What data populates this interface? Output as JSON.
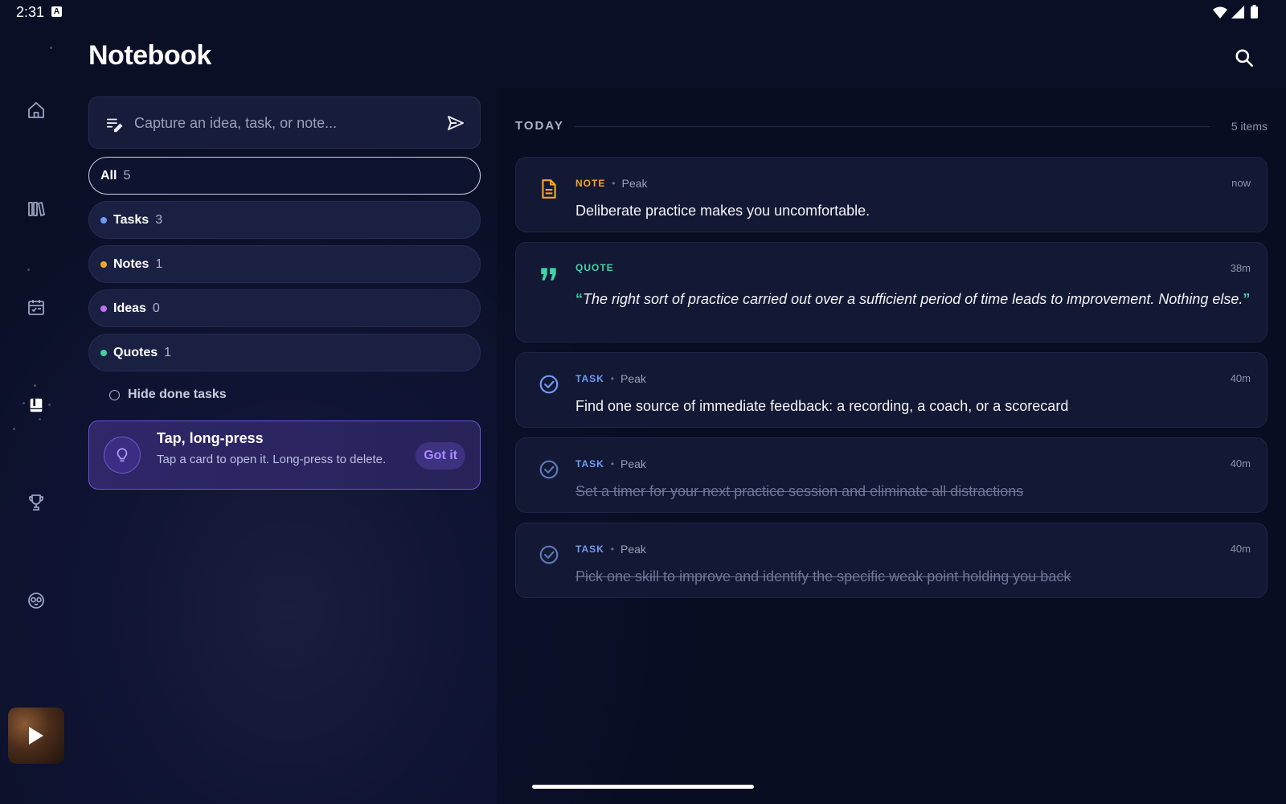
{
  "status_bar": {
    "time": "2:31",
    "badge": "A"
  },
  "header": {
    "title": "Notebook"
  },
  "nav": {
    "items": [
      {
        "id": "home",
        "icon": "home-icon"
      },
      {
        "id": "library",
        "icon": "library-icon"
      },
      {
        "id": "calendar",
        "icon": "calendar-icon"
      },
      {
        "id": "notebook",
        "icon": "notebook-icon",
        "active": true
      },
      {
        "id": "trophy",
        "icon": "trophy-icon"
      },
      {
        "id": "mascot",
        "icon": "owl-icon"
      }
    ]
  },
  "capture": {
    "placeholder": "Capture an idea, task, or note..."
  },
  "filters": [
    {
      "label": "All",
      "count": "5",
      "active": true
    },
    {
      "label": "Tasks",
      "count": "3",
      "color": "#6f9cf5"
    },
    {
      "label": "Notes",
      "count": "1",
      "color": "#f5a524"
    },
    {
      "label": "Ideas",
      "count": "0",
      "color": "#c56ef0"
    },
    {
      "label": "Quotes",
      "count": "1",
      "color": "#3fd4a6"
    }
  ],
  "hide_done": {
    "label": "Hide done tasks"
  },
  "tip": {
    "title": "Tap, long-press",
    "body": "Tap a card to open it. Long-press to delete.",
    "action": "Got it"
  },
  "section": {
    "label": "TODAY",
    "count": "5 items"
  },
  "items": [
    {
      "kind": "NOTE",
      "kind_color": "#f5a524",
      "source": "Peak",
      "time": "now",
      "text": "Deliberate practice makes you uncomfortable.",
      "done": false
    },
    {
      "kind": "QUOTE",
      "kind_color": "#3fd4a6",
      "source": "",
      "time": "38m",
      "text": "The right sort of practice  carried out over a sufficient period of time leads to improvement. Nothing else.",
      "open_quote": "“",
      "close_quote": "”"
    },
    {
      "kind": "TASK",
      "kind_color": "#6f9cf5",
      "source": "Peak",
      "time": "40m",
      "text": "Find one source of immediate feedback: a recording, a coach, or a scorecard",
      "done": false
    },
    {
      "kind": "TASK",
      "kind_color": "#6f9cf5",
      "source": "Peak",
      "time": "40m",
      "text": "Set a timer for your next practice session and eliminate all distractions",
      "done": true
    },
    {
      "kind": "TASK",
      "kind_color": "#6f9cf5",
      "source": "Peak",
      "time": "40m",
      "text": "Pick one skill to improve and identify the specific weak point holding you back",
      "done": true
    }
  ],
  "separator": "•"
}
